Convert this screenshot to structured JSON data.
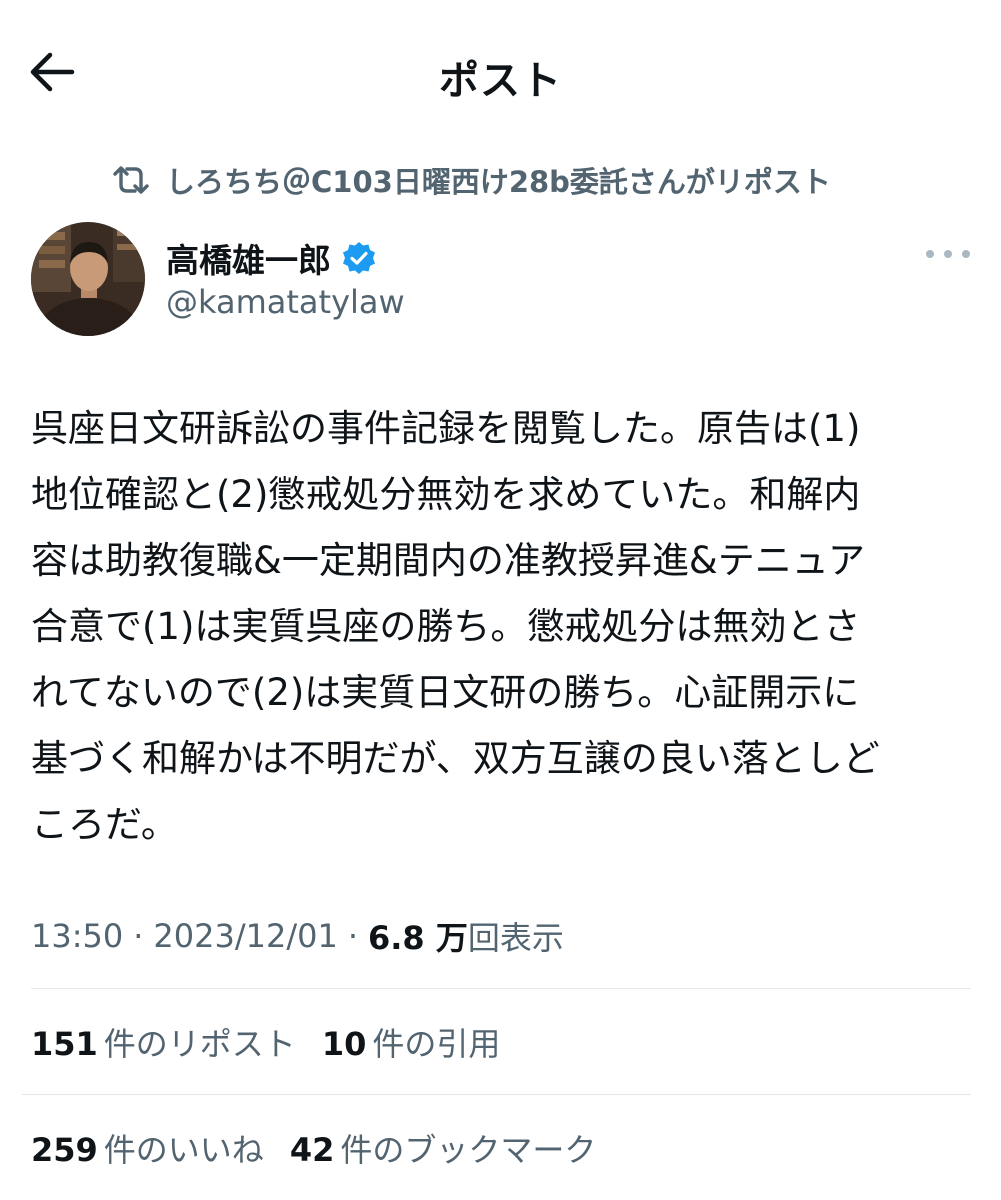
{
  "header": {
    "title": "ポスト"
  },
  "repost": {
    "text": "しろちち＠C103日曜西け28b委託さんがリポスト"
  },
  "author": {
    "name": "高橋雄一郎",
    "handle": "@kamatatylaw"
  },
  "tweet": {
    "lines": [
      "呉座日文研訴訟の事件記録を閲覧した。原告は(1)",
      "地位確認と(2)懲戒処分無効を求めていた。和解内",
      "容は助教復職&一定期間内の准教授昇進&テニュア",
      "合意で(1)は実質呉座の勝ち。懲戒処分は無効とさ",
      "れてないので(2)は実質日文研の勝ち。心証開示に",
      "基づく和解かは不明だが、双方互譲の良い落としど",
      "ころだ。"
    ]
  },
  "meta": {
    "time": "13:50",
    "separator": "·",
    "date": "2023/12/01",
    "views_count": "6.8 万",
    "views_label": "回表示"
  },
  "stats": {
    "reposts_count": "151",
    "reposts_label": "件のリポスト",
    "quotes_count": "10",
    "quotes_label": "件の引用",
    "likes_count": "259",
    "likes_label": "件のいいね",
    "bookmarks_count": "42",
    "bookmarks_label": "件のブックマーク"
  },
  "icons": {
    "back": "arrow-left-icon",
    "repost": "repost-icon",
    "verified": "verified-badge-icon",
    "more": "more-horizontal-icon"
  },
  "colors": {
    "text_primary": "#0f1419",
    "text_secondary": "#536471",
    "verified": "#1d9bf0",
    "divider": "#e4e8eb"
  }
}
